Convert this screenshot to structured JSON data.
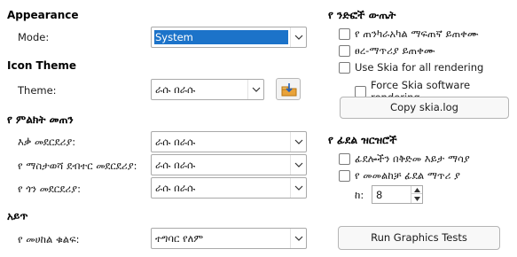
{
  "appearance": {
    "title": "Appearance",
    "mode_label": "Mode:",
    "mode_value": "System"
  },
  "icon_theme": {
    "title": "Icon Theme",
    "theme_label": "Theme:",
    "theme_value": "ራሱ በራሱ"
  },
  "icon_size": {
    "title": "የ ምልክት መጠን",
    "toolbar_label": "እቃ መደርደሪያ:",
    "toolbar_value": "ራሱ በራሱ",
    "notebookbar_label": "የ ማስታወሻ ደብተር መደርደሪያ:",
    "notebookbar_value": "ራሱ በራሱ",
    "sidebar_label": "የ ጎን መደርደሪያ:",
    "sidebar_value": "ራሱ በራሱ"
  },
  "style": {
    "title": "አይጥ",
    "mouse_label": "የ መሀከል ቁልፍ:",
    "mouse_value": "ተግባር የለም"
  },
  "graphics_output": {
    "title": "የ ንድፎች ውጤት",
    "hw_accel_label": "የ ጠንካራአካል ማፍጠኛ ይጠቀሙ",
    "antialias_label": "ፀረ-ማጥሪያ ይጠቀሙ",
    "skia_label": "Use Skia for all rendering",
    "force_skia_label": "Force Skia software rendering",
    "copy_skia_button": "Copy skia.log"
  },
  "font_lists": {
    "title": "የ ፊደል ዝርዝሮች",
    "preview_label": "ፊደሎችን በቅድመ እይታ ማሳያ",
    "screen_aa_label": "የ መመልከቻ ፊደል ማጥሪ ያ",
    "from_label": "ከ:",
    "from_value": "8"
  },
  "run_tests_button": "Run Graphics Tests"
}
